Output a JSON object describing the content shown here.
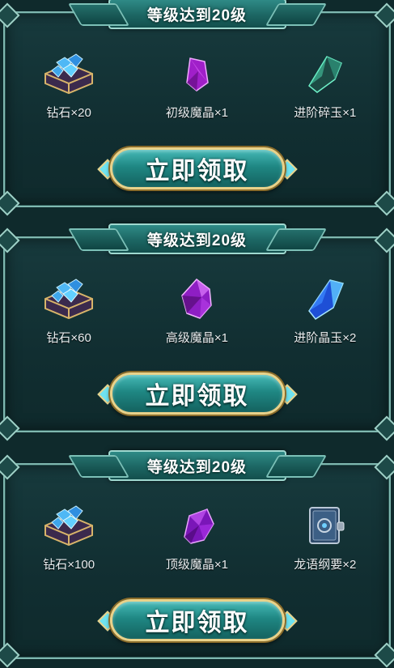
{
  "rewards": [
    {
      "banner": "等级达到20级",
      "items": [
        {
          "icon": "diamond-chest-icon",
          "label": "钻石×20"
        },
        {
          "icon": "purple-crystal-icon",
          "label": "初级魔晶×1"
        },
        {
          "icon": "green-shard-icon",
          "label": "进阶碎玉×1"
        }
      ],
      "button": "立即领取"
    },
    {
      "banner": "等级达到20级",
      "items": [
        {
          "icon": "diamond-chest-icon",
          "label": "钻石×60"
        },
        {
          "icon": "purple-gem-icon",
          "label": "高级魔晶×1"
        },
        {
          "icon": "blue-crystal-icon",
          "label": "进阶晶玉×2"
        }
      ],
      "button": "立即领取"
    },
    {
      "banner": "等级达到20级",
      "items": [
        {
          "icon": "diamond-chest-icon",
          "label": "钻石×100"
        },
        {
          "icon": "violet-gem-icon",
          "label": "顶级魔晶×1"
        },
        {
          "icon": "dragon-book-icon",
          "label": "龙语纲要×2"
        }
      ],
      "button": "立即领取"
    }
  ],
  "colors": {
    "background": "#0f2a2c",
    "frame": "#7fb8b0",
    "button_border": "#e9d28a",
    "button_fill": "#1f8783"
  }
}
